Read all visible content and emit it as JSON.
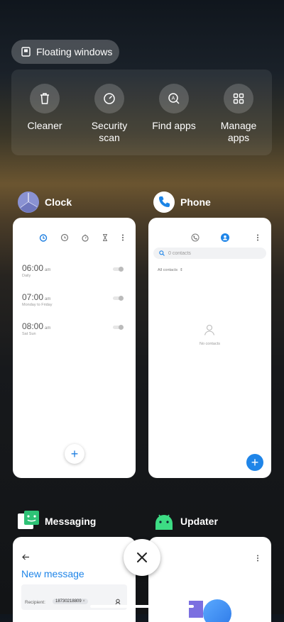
{
  "floating_windows": {
    "label": "Floating windows"
  },
  "quick_actions": [
    {
      "label_line1": "Cleaner",
      "label_line2": "",
      "icon": "trash-icon"
    },
    {
      "label_line1": "Security",
      "label_line2": "scan",
      "icon": "security-gauge-icon"
    },
    {
      "label_line1": "Find apps",
      "label_line2": "",
      "icon": "find-apps-icon"
    },
    {
      "label_line1": "Manage",
      "label_line2": "apps",
      "icon": "grid-icon"
    }
  ],
  "apps": {
    "clock": {
      "name": "Clock",
      "alarms": [
        {
          "time": "06:00",
          "ampm": "am",
          "repeat": "Daily"
        },
        {
          "time": "07:00",
          "ampm": "am",
          "repeat": "Monday to Friday"
        },
        {
          "time": "08:00",
          "ampm": "am",
          "repeat": "Sat Sun"
        }
      ],
      "add_label": "+"
    },
    "phone": {
      "name": "Phone",
      "search_placeholder": "0 contacts",
      "filter": "All contacts",
      "empty_text": "No contacts",
      "add_label": "+"
    },
    "messaging": {
      "name": "Messaging",
      "title": "New message",
      "recipient_label": "Recipient:",
      "recipient_chip": "18730218809"
    },
    "updater": {
      "name": "Updater"
    }
  },
  "colors": {
    "accent": "#1f85e8",
    "clock_tab_active": "#1f7fe0"
  }
}
